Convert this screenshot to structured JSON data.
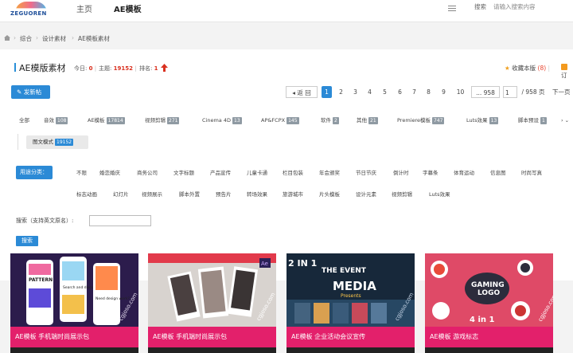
{
  "header": {
    "logo_text": "ZEGUOREN",
    "nav": [
      "主页",
      "AE模板"
    ],
    "search_label": "搜索",
    "search_placeholder": "请输入搜索内容"
  },
  "breadcrumb": [
    "综合",
    "设计素材",
    "AE模板素材"
  ],
  "forum": {
    "title": "AE模版素材",
    "today_label": "今日:",
    "today_value": "0",
    "topics_label": "主题:",
    "topics_value": "19152",
    "rank_label": "排名:",
    "rank_value": "1",
    "favorite_label": "收藏本版",
    "favorite_count": "(8)",
    "rss_label": "订"
  },
  "toolbar": {
    "post_label": "发新帖",
    "back_label": "返 回",
    "pages": [
      "1",
      "2",
      "3",
      "4",
      "5",
      "6",
      "7",
      "8",
      "9",
      "10"
    ],
    "ellipsis": "... 958",
    "page_input": "1",
    "total_pages": "/ 958 页",
    "next_label": "下一页"
  },
  "categories": [
    {
      "label": "全部",
      "count": ""
    },
    {
      "label": "音效",
      "count": "108"
    },
    {
      "label": "AE模板",
      "count": "17814"
    },
    {
      "label": "视频剪辑",
      "count": "271"
    },
    {
      "label": "Cinema 4D",
      "count": "13"
    },
    {
      "label": "AP&FCPX",
      "count": "145"
    },
    {
      "label": "软件",
      "count": "2"
    },
    {
      "label": "其他",
      "count": "21"
    },
    {
      "label": "Premiere模板",
      "count": "747"
    },
    {
      "label": "Luts效果",
      "count": "13"
    },
    {
      "label": "脚本预设",
      "count": "1"
    }
  ],
  "view_mode": {
    "label": "图文模式",
    "count": "19152"
  },
  "use_filter": {
    "label": "用途分类：",
    "row1": [
      "不限",
      "婚恋婚庆",
      "商务公司",
      "文字标题",
      "产品宣传",
      "儿童卡通",
      "栏目包装",
      "年会颁奖",
      "节日节庆",
      "倒计时",
      "字幕条",
      "体育运动",
      "信息图",
      "时尚写真"
    ],
    "row2": [
      "标志动画",
      "幻灯片",
      "视频展示",
      "脚本外置",
      "预告片",
      "转场效果",
      "旅游城市",
      "片头模板",
      "设计元素",
      "视频剪辑",
      "Luts效果"
    ]
  },
  "search_box": {
    "label": "搜索（支持英文原名）:",
    "button": "搜索"
  },
  "cards": [
    {
      "caption": "AE模板 手机端时尚展示包",
      "color": "#2e1d4f"
    },
    {
      "caption": "AE模板 手机端时尚展示包",
      "color": "#d8d3cf"
    },
    {
      "caption": "AE模板 企业活动会议宣传",
      "color": "#1a2c3c"
    },
    {
      "caption": "AE模板 游戏标志",
      "color": "#d93a5c"
    }
  ],
  "card_texts": {
    "c1_pattern": "PATTERN",
    "c1_search": "Search and discover",
    "c1_need": "Need design work?",
    "c2_ae": "Ae",
    "c3_2in1": "2 IN 1",
    "c3_event": "THE EVENT",
    "c3_media": "MEDIA",
    "c3_presents": "Presents",
    "c4_gaming": "GAMING",
    "c4_logo": "LOGO",
    "c4_4in1": "4 in 1",
    "watermark": "cgjoso.com"
  }
}
